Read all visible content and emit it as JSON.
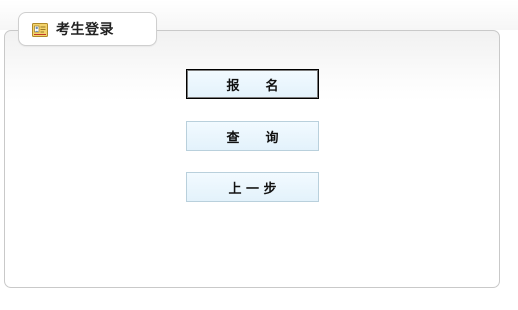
{
  "header": {
    "title": "考生登录",
    "icon": "id-card-icon"
  },
  "buttons": {
    "register_label": "报　　名",
    "query_label": "查　　询",
    "back_label": "上 一 步"
  },
  "colors": {
    "button_bg": "#e8f5fc",
    "button_border": "#b9d0dc",
    "panel_border": "#c9c9c9"
  }
}
